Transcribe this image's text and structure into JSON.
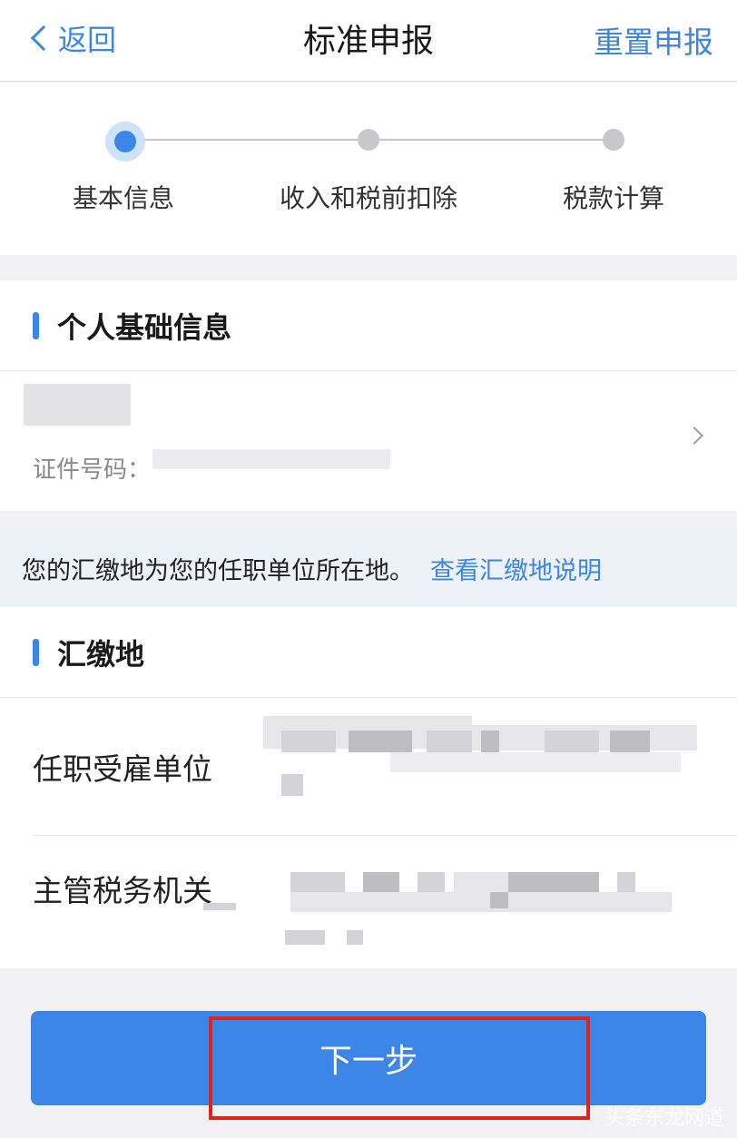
{
  "nav": {
    "back_label": "返回",
    "title": "标准申报",
    "action_label": "重置申报"
  },
  "steps": [
    {
      "label": "基本信息",
      "state": "active"
    },
    {
      "label": "收入和税前扣除",
      "state": "pending"
    },
    {
      "label": "税款计算",
      "state": "pending"
    }
  ],
  "personal_section": {
    "title": "个人基础信息",
    "id_label": "证件号码："
  },
  "notice": {
    "text": "您的汇缴地为您的任职单位所在地。",
    "link": "查看汇缴地说明"
  },
  "remit_section": {
    "title": "汇缴地",
    "fields": [
      {
        "label": "任职受雇单位"
      },
      {
        "label": "主管税务机关"
      }
    ]
  },
  "next_button_label": "下一步",
  "watermark": "头条东龙网道",
  "colors": {
    "accent": "#3b86e6",
    "highlight": "#e2231a",
    "background": "#f2f2f5"
  }
}
